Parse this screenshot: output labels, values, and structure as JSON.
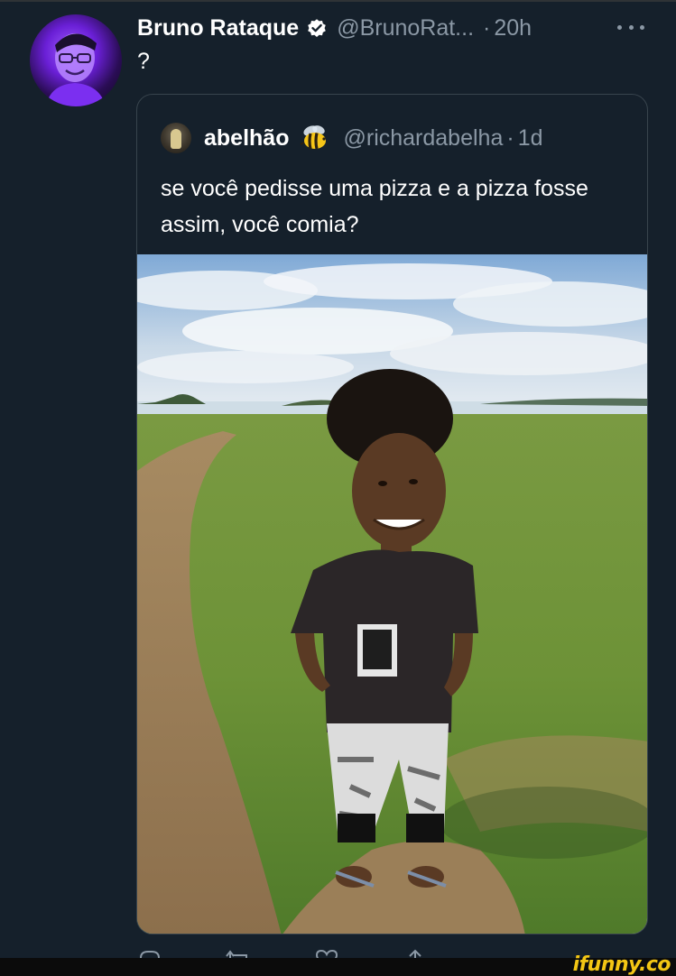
{
  "tweet": {
    "author_name": "Bruno Rataque",
    "handle": "@BrunoRat...",
    "separator": "·",
    "time": "20h",
    "text": "?"
  },
  "quote": {
    "author_name": "abelhão",
    "handle": "@richardabelha",
    "separator": "·",
    "time": "1d",
    "text": "se você pedisse uma pizza e a pizza fosse assim, você comia?"
  },
  "watermark": "ifunny.co",
  "colors": {
    "background": "#15202b",
    "secondary_text": "#8b98a5",
    "verified": "#ffffff",
    "card_border": "#38444d",
    "watermark": "#f3c614"
  },
  "icons": [
    "verified-badge-icon",
    "more-icon",
    "bee-icon",
    "reply-icon",
    "retweet-icon",
    "like-icon",
    "share-icon"
  ]
}
